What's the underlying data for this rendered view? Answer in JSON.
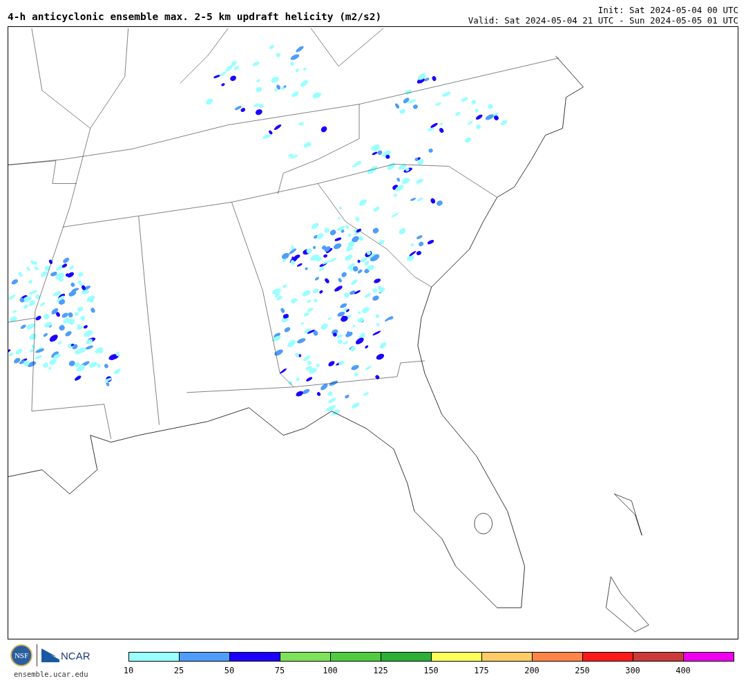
{
  "title": "4-h anticyclonic ensemble max. 2-5 km updraft helicity (m2/s2)",
  "init": "Init: Sat 2024-05-04 00 UTC",
  "valid": "Valid: Sat 2024-05-04 21 UTC - Sun 2024-05-05 01 UTC",
  "logos": {
    "nsf": "NSF",
    "ncar": "NCAR"
  },
  "site": "ensemble.ucar.edu",
  "colorbar": {
    "bins": [
      {
        "label": "10",
        "color": "#99ffff"
      },
      {
        "label": "25",
        "color": "#4f9dfa"
      },
      {
        "label": "50",
        "color": "#1c00ff"
      },
      {
        "label": "75",
        "color": "#7de35a"
      },
      {
        "label": "100",
        "color": "#4fcc40"
      },
      {
        "label": "125",
        "color": "#2caf35"
      },
      {
        "label": "150",
        "color": "#ffff5a"
      },
      {
        "label": "175",
        "color": "#ffcb66"
      },
      {
        "label": "200",
        "color": "#ff8447"
      },
      {
        "label": "250",
        "color": "#ff1a1a"
      },
      {
        "label": "300",
        "color": "#cc3a3a"
      },
      {
        "label": "400",
        "color": "#ee00ee"
      }
    ]
  }
}
